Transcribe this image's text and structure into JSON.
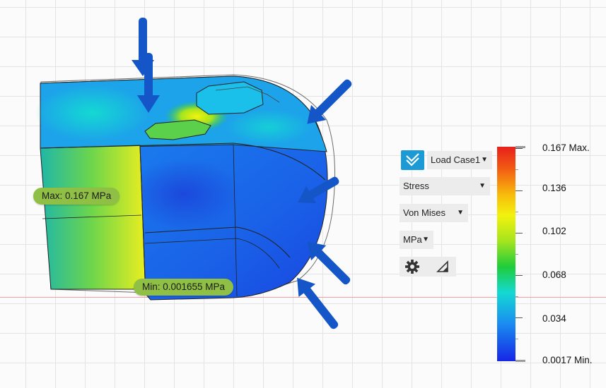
{
  "probes": {
    "max_label": "Max: 0.167 MPa",
    "min_label": "Min: 0.001655 MPa"
  },
  "panel": {
    "load_case": "Load Case1",
    "result_type": "Stress",
    "stress_component": "Von Mises",
    "unit": "MPa",
    "icons": [
      "checkmark-icon",
      "gear-icon",
      "anisotropic-triangle-icon"
    ]
  },
  "legend": {
    "labels": [
      "0.167 Max.",
      "0.136",
      "0.102",
      "0.068",
      "0.034",
      "0.0017 Min."
    ],
    "colors": {
      "max": "#e8201d",
      "high": "#f3f20e",
      "mid": "#1fcc3b",
      "low": "#14d9d2",
      "min": "#1626e6"
    }
  },
  "colors": {
    "load_arrow": "#1456c8",
    "probe_bg": "#8fc045",
    "accent": "#1b9ad6"
  }
}
